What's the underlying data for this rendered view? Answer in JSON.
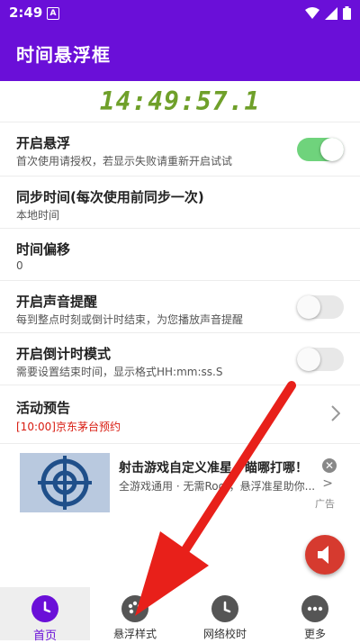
{
  "status_bar": {
    "time": "2:49",
    "notification_icon": "a-icon",
    "icons": [
      "wifi-icon",
      "signal-icon",
      "battery-icon"
    ]
  },
  "app_bar": {
    "title": "时间悬浮框"
  },
  "clock": {
    "display": "14:49:57.1"
  },
  "settings": [
    {
      "title": "开启悬浮",
      "subtitle": "首次使用请授权，若显示失败请重新开启试试",
      "toggle": true
    },
    {
      "title": "同步时间(每次使用前同步一次)",
      "subtitle": "本地时间"
    },
    {
      "title": "时间偏移",
      "subtitle": "0"
    },
    {
      "title": "开启声音提醒",
      "subtitle": "每到整点时刻或倒计时结束，为您播放声音提醒",
      "toggle": false
    },
    {
      "title": "开启倒计时模式",
      "subtitle": "需要设置结束时间，显示格式HH:mm:ss.S",
      "toggle": false
    },
    {
      "title": "活动预告",
      "subtitle": "[10:00]京东茅台预约"
    }
  ],
  "ad": {
    "title": "射击游戏自定义准星，瞄哪打哪！",
    "subtitle": "全游戏通用 · 无需Root，悬浮准星助你...",
    "tag": "广告"
  },
  "bottom_nav": [
    {
      "label": "首页",
      "icon": "clock-icon",
      "active": true
    },
    {
      "label": "悬浮样式",
      "icon": "palette-icon",
      "active": false
    },
    {
      "label": "网络校时",
      "icon": "clock-icon",
      "active": false
    },
    {
      "label": "更多",
      "icon": "more-icon",
      "active": false
    }
  ],
  "colors": {
    "primary": "#6a0fd8",
    "clock": "#6fa02a",
    "toggle_on": "#6fd37c",
    "alert_red": "#d81b10",
    "fab": "#d63a2f",
    "annotation_arrow": "#e8201a"
  }
}
